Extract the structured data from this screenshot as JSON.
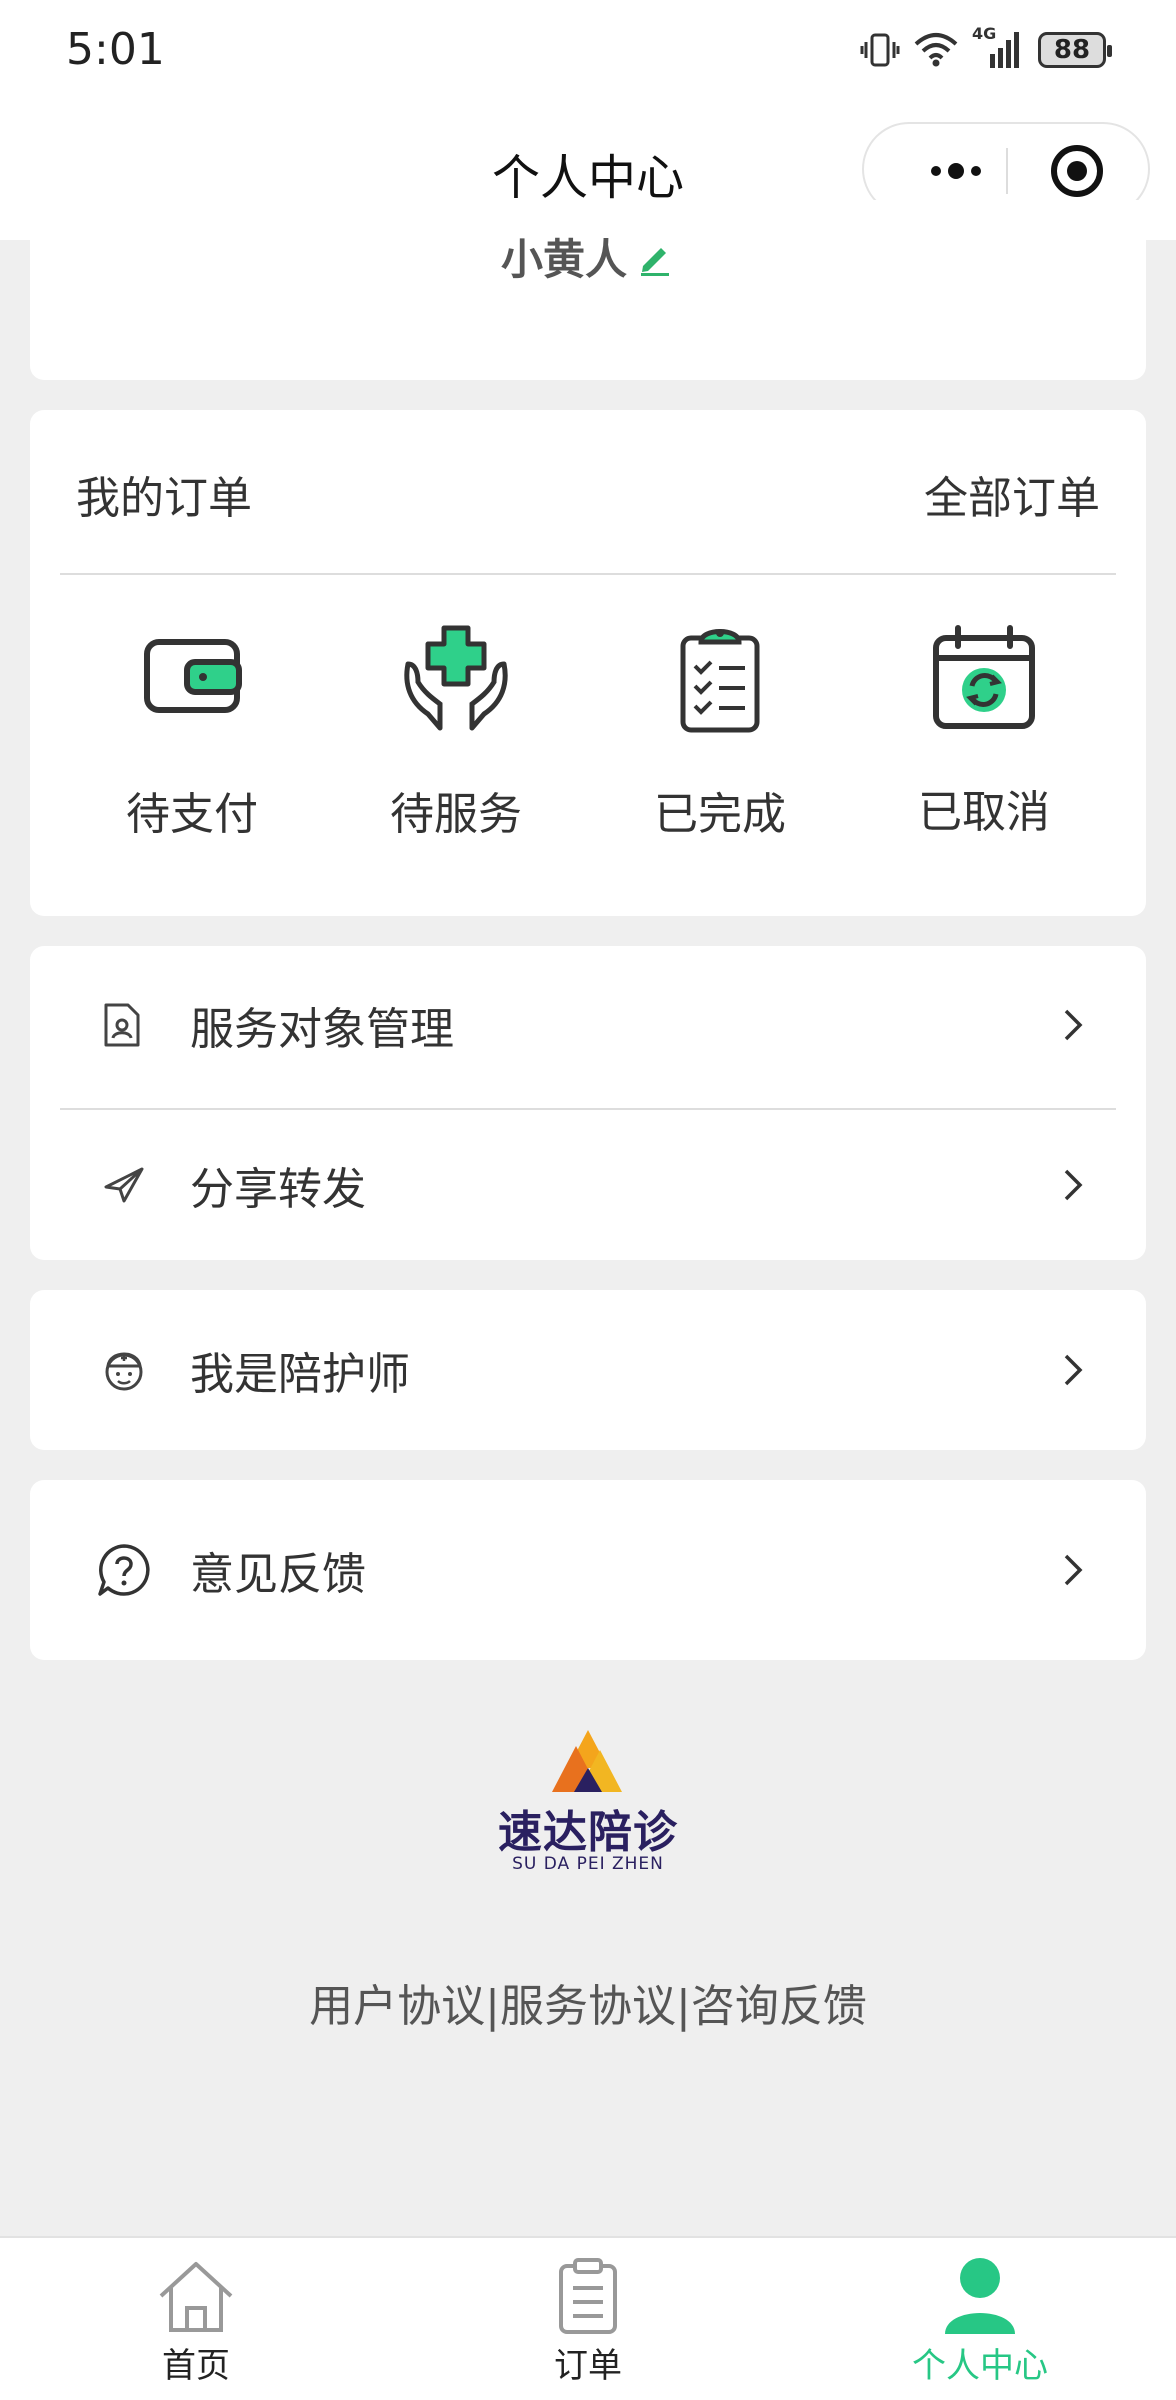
{
  "status_bar": {
    "time": "5:01",
    "network": "4G",
    "battery": "88"
  },
  "nav": {
    "title": "个人中心"
  },
  "profile": {
    "name": "小黄人"
  },
  "orders": {
    "title": "我的订单",
    "all_label": "全部订单",
    "items": [
      {
        "label": "待支付",
        "icon": "wallet-icon"
      },
      {
        "label": "待服务",
        "icon": "caring-hands-icon"
      },
      {
        "label": "已完成",
        "icon": "clipboard-check-icon"
      },
      {
        "label": "已取消",
        "icon": "calendar-refresh-icon"
      }
    ]
  },
  "menu": {
    "service_target": "服务对象管理",
    "share": "分享转发",
    "escort": "我是陪护师",
    "feedback": "意见反馈"
  },
  "brand": {
    "name_cn": "速达陪诊",
    "name_en": "SU DA PEI ZHEN"
  },
  "footer": {
    "links": "用户协议|服务协议|咨询反馈"
  },
  "tabs": [
    {
      "label": "首页",
      "icon": "home-icon"
    },
    {
      "label": "订单",
      "icon": "order-list-icon"
    },
    {
      "label": "个人中心",
      "icon": "user-icon"
    }
  ],
  "colors": {
    "accent": "#27c785",
    "background": "#efefef"
  }
}
